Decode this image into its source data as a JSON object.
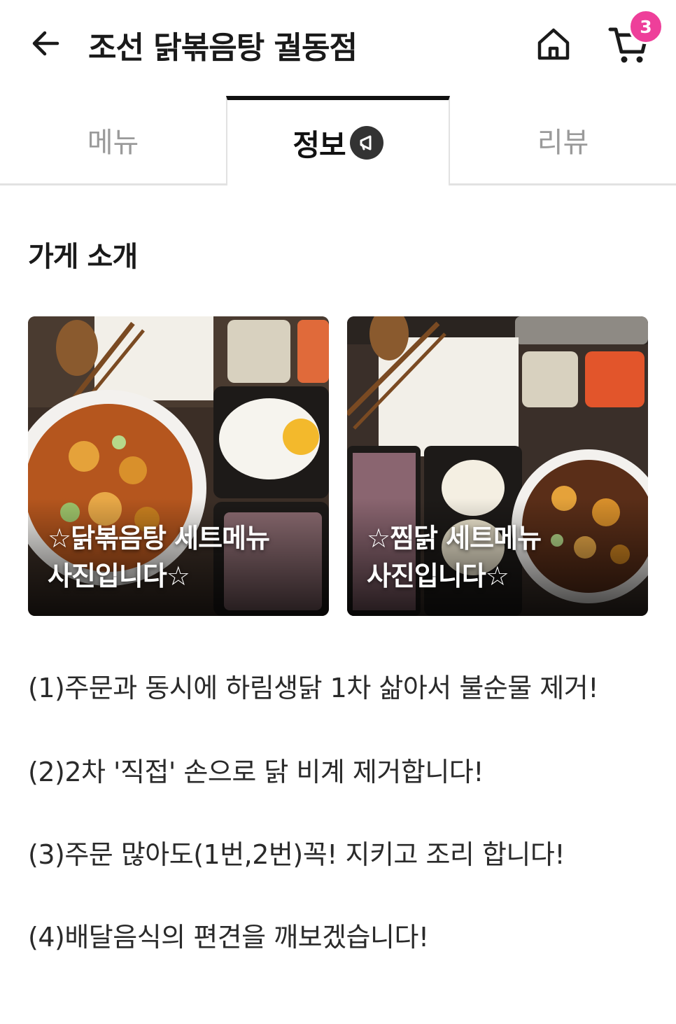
{
  "header": {
    "title": "조선 닭볶음탕 궐동점",
    "cart_count": "3"
  },
  "tabs": [
    {
      "label": "메뉴"
    },
    {
      "label": "정보"
    },
    {
      "label": "리뷰"
    }
  ],
  "section": {
    "title": "가게 소개"
  },
  "photos": [
    {
      "caption": "☆닭볶음탕 세트메뉴\n사진입니다☆"
    },
    {
      "caption": "☆찜닭 세트메뉴\n사진입니다☆"
    }
  ],
  "description": [
    "(1)주문과 동시에 하림생닭 1차 삶아서 불순물 제거!",
    "(2)2차 '직접' 손으로 닭 비계 제거합니다!",
    "(3)주문 많아도(1번,2번)꼭! 지키고 조리 합니다!",
    "(4)배달음식의 편견을 깨보겠습니다!"
  ],
  "colors": {
    "badge": "#ee3f9a",
    "active_tab_border": "#111111",
    "inactive_tab_text": "#9a9a9a"
  }
}
